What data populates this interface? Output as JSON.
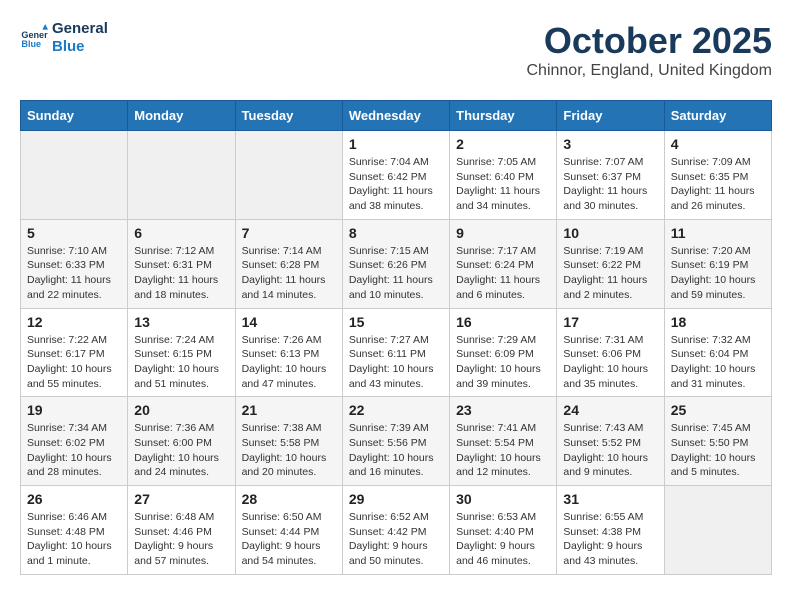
{
  "header": {
    "logo_general": "General",
    "logo_blue": "Blue",
    "month": "October 2025",
    "location": "Chinnor, England, United Kingdom"
  },
  "weekdays": [
    "Sunday",
    "Monday",
    "Tuesday",
    "Wednesday",
    "Thursday",
    "Friday",
    "Saturday"
  ],
  "weeks": [
    [
      {
        "day": "",
        "info": ""
      },
      {
        "day": "",
        "info": ""
      },
      {
        "day": "",
        "info": ""
      },
      {
        "day": "1",
        "info": "Sunrise: 7:04 AM\nSunset: 6:42 PM\nDaylight: 11 hours\nand 38 minutes."
      },
      {
        "day": "2",
        "info": "Sunrise: 7:05 AM\nSunset: 6:40 PM\nDaylight: 11 hours\nand 34 minutes."
      },
      {
        "day": "3",
        "info": "Sunrise: 7:07 AM\nSunset: 6:37 PM\nDaylight: 11 hours\nand 30 minutes."
      },
      {
        "day": "4",
        "info": "Sunrise: 7:09 AM\nSunset: 6:35 PM\nDaylight: 11 hours\nand 26 minutes."
      }
    ],
    [
      {
        "day": "5",
        "info": "Sunrise: 7:10 AM\nSunset: 6:33 PM\nDaylight: 11 hours\nand 22 minutes."
      },
      {
        "day": "6",
        "info": "Sunrise: 7:12 AM\nSunset: 6:31 PM\nDaylight: 11 hours\nand 18 minutes."
      },
      {
        "day": "7",
        "info": "Sunrise: 7:14 AM\nSunset: 6:28 PM\nDaylight: 11 hours\nand 14 minutes."
      },
      {
        "day": "8",
        "info": "Sunrise: 7:15 AM\nSunset: 6:26 PM\nDaylight: 11 hours\nand 10 minutes."
      },
      {
        "day": "9",
        "info": "Sunrise: 7:17 AM\nSunset: 6:24 PM\nDaylight: 11 hours\nand 6 minutes."
      },
      {
        "day": "10",
        "info": "Sunrise: 7:19 AM\nSunset: 6:22 PM\nDaylight: 11 hours\nand 2 minutes."
      },
      {
        "day": "11",
        "info": "Sunrise: 7:20 AM\nSunset: 6:19 PM\nDaylight: 10 hours\nand 59 minutes."
      }
    ],
    [
      {
        "day": "12",
        "info": "Sunrise: 7:22 AM\nSunset: 6:17 PM\nDaylight: 10 hours\nand 55 minutes."
      },
      {
        "day": "13",
        "info": "Sunrise: 7:24 AM\nSunset: 6:15 PM\nDaylight: 10 hours\nand 51 minutes."
      },
      {
        "day": "14",
        "info": "Sunrise: 7:26 AM\nSunset: 6:13 PM\nDaylight: 10 hours\nand 47 minutes."
      },
      {
        "day": "15",
        "info": "Sunrise: 7:27 AM\nSunset: 6:11 PM\nDaylight: 10 hours\nand 43 minutes."
      },
      {
        "day": "16",
        "info": "Sunrise: 7:29 AM\nSunset: 6:09 PM\nDaylight: 10 hours\nand 39 minutes."
      },
      {
        "day": "17",
        "info": "Sunrise: 7:31 AM\nSunset: 6:06 PM\nDaylight: 10 hours\nand 35 minutes."
      },
      {
        "day": "18",
        "info": "Sunrise: 7:32 AM\nSunset: 6:04 PM\nDaylight: 10 hours\nand 31 minutes."
      }
    ],
    [
      {
        "day": "19",
        "info": "Sunrise: 7:34 AM\nSunset: 6:02 PM\nDaylight: 10 hours\nand 28 minutes."
      },
      {
        "day": "20",
        "info": "Sunrise: 7:36 AM\nSunset: 6:00 PM\nDaylight: 10 hours\nand 24 minutes."
      },
      {
        "day": "21",
        "info": "Sunrise: 7:38 AM\nSunset: 5:58 PM\nDaylight: 10 hours\nand 20 minutes."
      },
      {
        "day": "22",
        "info": "Sunrise: 7:39 AM\nSunset: 5:56 PM\nDaylight: 10 hours\nand 16 minutes."
      },
      {
        "day": "23",
        "info": "Sunrise: 7:41 AM\nSunset: 5:54 PM\nDaylight: 10 hours\nand 12 minutes."
      },
      {
        "day": "24",
        "info": "Sunrise: 7:43 AM\nSunset: 5:52 PM\nDaylight: 10 hours\nand 9 minutes."
      },
      {
        "day": "25",
        "info": "Sunrise: 7:45 AM\nSunset: 5:50 PM\nDaylight: 10 hours\nand 5 minutes."
      }
    ],
    [
      {
        "day": "26",
        "info": "Sunrise: 6:46 AM\nSunset: 4:48 PM\nDaylight: 10 hours\nand 1 minute."
      },
      {
        "day": "27",
        "info": "Sunrise: 6:48 AM\nSunset: 4:46 PM\nDaylight: 9 hours\nand 57 minutes."
      },
      {
        "day": "28",
        "info": "Sunrise: 6:50 AM\nSunset: 4:44 PM\nDaylight: 9 hours\nand 54 minutes."
      },
      {
        "day": "29",
        "info": "Sunrise: 6:52 AM\nSunset: 4:42 PM\nDaylight: 9 hours\nand 50 minutes."
      },
      {
        "day": "30",
        "info": "Sunrise: 6:53 AM\nSunset: 4:40 PM\nDaylight: 9 hours\nand 46 minutes."
      },
      {
        "day": "31",
        "info": "Sunrise: 6:55 AM\nSunset: 4:38 PM\nDaylight: 9 hours\nand 43 minutes."
      },
      {
        "day": "",
        "info": ""
      }
    ]
  ]
}
